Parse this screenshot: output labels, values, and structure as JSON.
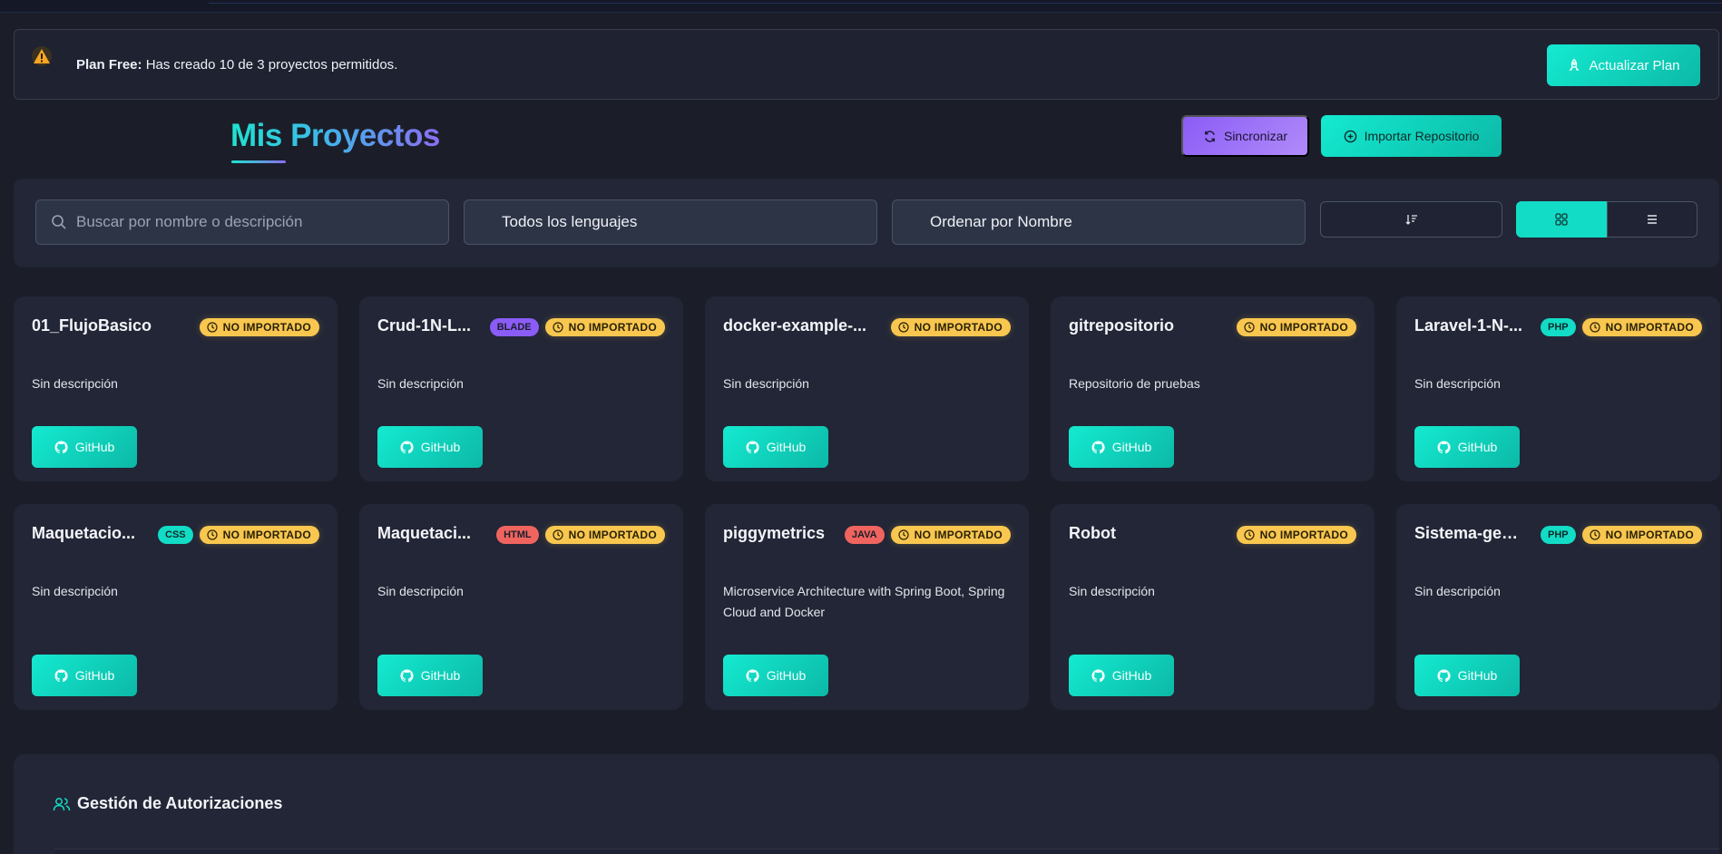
{
  "banner": {
    "plan_label": "Plan Free:",
    "message": " Has creado 10 de 3 proyectos permitidos.",
    "upgrade_label": "Actualizar Plan"
  },
  "header": {
    "title": "Mis Proyectos",
    "sync_label": "Sincronizar",
    "import_label": "Importar Repositorio"
  },
  "filters": {
    "search_placeholder": "Buscar por nombre o descripción",
    "language_value": "Todos los lenguajes",
    "order_value": "Ordenar por Nombre"
  },
  "colors": {
    "accent": "#12dcc5",
    "sync": "#8b5cf6",
    "status": "#f9c74f"
  },
  "projects": [
    {
      "name": "01_FlujoBasico",
      "lang": "",
      "lang_color": "",
      "status": "NO IMPORTADO",
      "description": "Sin descripción",
      "button": "GitHub"
    },
    {
      "name": "Crud-1N-L...",
      "lang": "BLADE",
      "lang_color": "#8b5cf6",
      "status": "NO IMPORTADO",
      "description": "Sin descripción",
      "button": "GitHub"
    },
    {
      "name": "docker-example-...",
      "lang": "",
      "lang_color": "",
      "status": "NO IMPORTADO",
      "description": "Sin descripción",
      "button": "GitHub"
    },
    {
      "name": "gitrepositorio",
      "lang": "",
      "lang_color": "",
      "status": "NO IMPORTADO",
      "description": "Repositorio de pruebas",
      "button": "GitHub"
    },
    {
      "name": "Laravel-1-N-...",
      "lang": "PHP",
      "lang_color": "#12dcc5",
      "status": "NO IMPORTADO",
      "description": "Sin descripción",
      "button": "GitHub"
    },
    {
      "name": "Maquetacio...",
      "lang": "CSS",
      "lang_color": "#12dcc5",
      "status": "NO IMPORTADO",
      "description": "Sin descripción",
      "button": "GitHub"
    },
    {
      "name": "Maquetaci...",
      "lang": "HTML",
      "lang_color": "#f0645f",
      "status": "NO IMPORTADO",
      "description": "Sin descripción",
      "button": "GitHub"
    },
    {
      "name": "piggymetrics",
      "lang": "JAVA",
      "lang_color": "#f0645f",
      "status": "NO IMPORTADO",
      "description": "Microservice Architecture with Spring Boot, Spring Cloud and Docker",
      "button": "GitHub"
    },
    {
      "name": "Robot",
      "lang": "",
      "lang_color": "",
      "status": "NO IMPORTADO",
      "description": "Sin descripción",
      "button": "GitHub"
    },
    {
      "name": "Sistema-ges...",
      "lang": "PHP",
      "lang_color": "#12dcc5",
      "status": "NO IMPORTADO",
      "description": "Sin descripción",
      "button": "GitHub"
    }
  ],
  "authorizations": {
    "title": "Gestión de Autorizaciones"
  }
}
